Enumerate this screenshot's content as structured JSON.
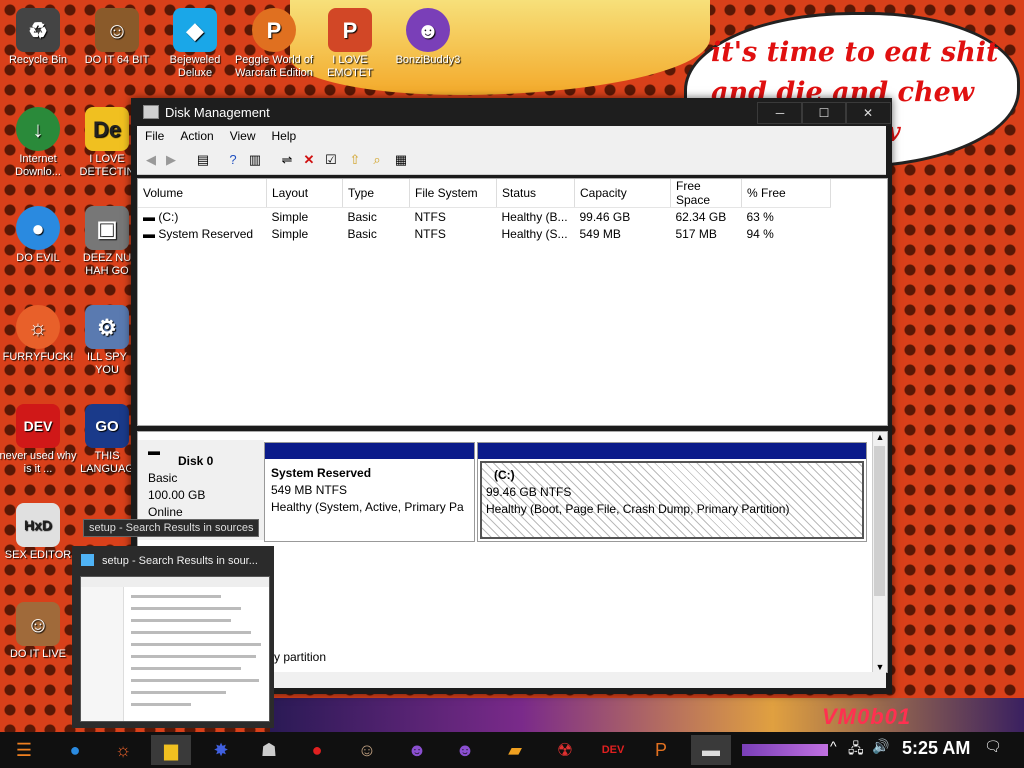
{
  "desktop": {
    "bubble_lines": [
      "it's time to eat shit",
      "and die and chew",
      "w"
    ],
    "watermark": "VM0b01",
    "icons": [
      {
        "label": "Recycle Bin",
        "icon": "recycle-bin-icon",
        "glyph": "♻",
        "color": "#444444"
      },
      {
        "label": "DO IT 64 BIT",
        "icon": "portrait-icon",
        "glyph": "☺",
        "color": "#8a5a2a"
      },
      {
        "label": "Bejeweled Deluxe",
        "icon": "gem-icon",
        "glyph": "◆",
        "color": "#1aa7e8"
      },
      {
        "label": "Peggle World of Warcraft Edition",
        "icon": "peggle-icon",
        "glyph": "P",
        "color": "#e07020"
      },
      {
        "label": "I LOVE EMOTET",
        "icon": "powerpoint-icon",
        "glyph": "P",
        "color": "#d24726"
      },
      {
        "label": "BonziBuddy3",
        "icon": "bonzi-icon",
        "glyph": "☻",
        "color": "#7a3fb8"
      },
      {
        "label": "Internet Downlo...",
        "icon": "download-manager-icon",
        "glyph": "↓",
        "color": "#2a8a3a"
      },
      {
        "label": "I LOVE DETECTIN",
        "icon": "de-icon",
        "glyph": "De",
        "color": "#f0c020"
      },
      {
        "label": "DO EVIL",
        "icon": "chrome-icon",
        "glyph": "●",
        "color": "#2a8ae0"
      },
      {
        "label": "DEEZ NU HAH GO",
        "icon": "windows-icon",
        "glyph": "▣",
        "color": "#777777"
      },
      {
        "label": "FURRYFUCK!",
        "icon": "firefox-icon",
        "glyph": "🦊",
        "color": "#e8602a"
      },
      {
        "label": "ILL SPY YOU",
        "icon": "spy-icon",
        "glyph": "⚙",
        "color": "#5a7ab0"
      },
      {
        "label": "never used why is it ...",
        "icon": "devcpp-icon",
        "glyph": "DEV",
        "color": "#d01818"
      },
      {
        "label": "THIS LANGUAG",
        "icon": "go-icon",
        "glyph": "GO",
        "color": "#1a3a8a"
      },
      {
        "label": "SEX EDITOR",
        "icon": "hxd-icon",
        "glyph": "HxD",
        "color": "#e0e0e0"
      },
      {
        "label": "DO IT LIVE",
        "icon": "portrait-icon",
        "glyph": "☺",
        "color": "#a06a3a"
      }
    ]
  },
  "window": {
    "title": "Disk Management",
    "menu": [
      "File",
      "Action",
      "View",
      "Help"
    ],
    "columns": [
      "Volume",
      "Layout",
      "Type",
      "File System",
      "Status",
      "Capacity",
      "Free Space",
      "% Free"
    ],
    "rows": [
      [
        "(C:)",
        "Simple",
        "Basic",
        "NTFS",
        "Healthy (B...",
        "99.46 GB",
        "62.34 GB",
        "63 %"
      ],
      [
        "System Reserved",
        "Simple",
        "Basic",
        "NTFS",
        "Healthy (S...",
        "549 MB",
        "517 MB",
        "94 %"
      ]
    ],
    "disk": {
      "name": "Disk 0",
      "type": "Basic",
      "size": "100.00 GB",
      "state": "Online"
    },
    "partitions": [
      {
        "name": "System Reserved",
        "size": "549 MB NTFS",
        "status": "Healthy (System, Active, Primary Pa"
      },
      {
        "name": "(C:)",
        "size": "99.46 GB NTFS",
        "status": "Healthy (Boot, Page File, Crash Dump, Primary Partition)"
      }
    ],
    "legend_fragment": "ry partition"
  },
  "taskbar_preview": {
    "tooltip": "setup - Search Results in sources",
    "title": "setup - Search Results in sour..."
  },
  "taskbar": {
    "clock": "5:25 AM"
  }
}
